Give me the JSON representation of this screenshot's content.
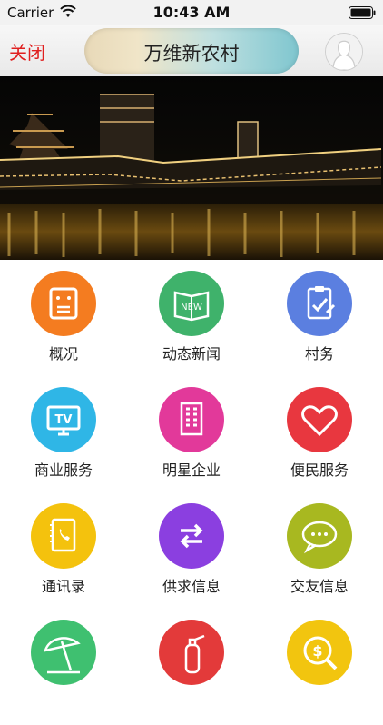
{
  "status_bar": {
    "carrier": "Carrier",
    "time": "10:43 AM"
  },
  "nav": {
    "close_label": "关闭",
    "title": "万维新农村"
  },
  "icons": [
    "overview-icon",
    "news-book-icon",
    "clipboard-icon",
    "tv-icon",
    "building-icon",
    "heart-icon",
    "phonebook-icon",
    "exchange-arrows-icon",
    "chat-bubble-icon",
    "beach-umbrella-icon",
    "fire-extinguisher-icon",
    "money-search-icon"
  ],
  "grid": [
    {
      "label": "概况",
      "color": "#f47c20"
    },
    {
      "label": "动态新闻",
      "color": "#3fb26b"
    },
    {
      "label": "村务",
      "color": "#5b7fe0"
    },
    {
      "label": "商业服务",
      "color": "#2fb6e6"
    },
    {
      "label": "明星企业",
      "color": "#e2399a"
    },
    {
      "label": "便民服务",
      "color": "#e8373f"
    },
    {
      "label": "通讯录",
      "color": "#f4c20d"
    },
    {
      "label": "供求信息",
      "color": "#8b3fe0"
    },
    {
      "label": "交友信息",
      "color": "#a8b820"
    },
    {
      "label": "",
      "color": "#3fc070"
    },
    {
      "label": "",
      "color": "#e33a3a"
    },
    {
      "label": "",
      "color": "#f2c50f"
    }
  ]
}
